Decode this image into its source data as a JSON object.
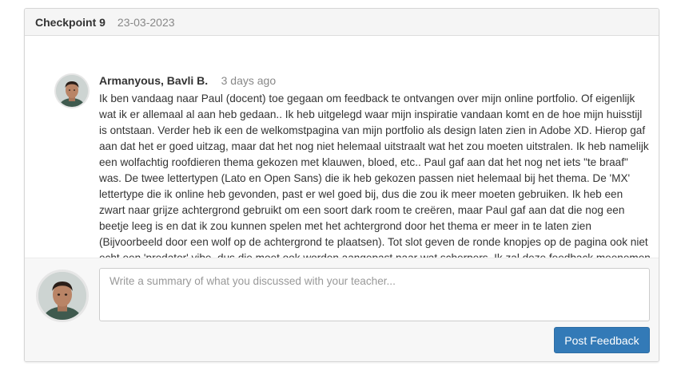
{
  "checkpoint": {
    "title": "Checkpoint 9",
    "date": "23-03-2023"
  },
  "comment": {
    "author": "Armanyous, Bavli B.",
    "time": "3 days ago",
    "text": "Ik ben vandaag naar Paul (docent) toe gegaan om feedback te ontvangen over mijn online portfolio. Of eigenlijk wat ik er allemaal al aan heb gedaan.. Ik heb uitgelegd waar mijn inspiratie vandaan komt en de hoe mijn huisstijl is ontstaan. Verder heb ik een de welkomstpagina van mijn portfolio als design laten zien in Adobe XD. Hierop gaf aan dat het er goed uitzag, maar dat het nog niet helemaal uitstraalt wat het zou moeten uitstralen. Ik heb namelijk een wolfachtig roofdieren thema gekozen met klauwen, bloed, etc.. Paul gaf aan dat het nog net iets \"te braaf\" was. De twee lettertypen (Lato en Open Sans) die ik heb gekozen passen niet helemaal bij het thema. De 'MX' lettertype die ik online heb gevonden, past er wel goed bij, dus die zou ik meer moeten gebruiken. Ik heb een zwart naar grijze achtergrond gebruikt om een soort dark room te creëren, maar Paul gaf aan dat die nog een beetje leeg is en dat ik zou kunnen spelen met het achtergrond door het thema er meer in te laten zien (Bijvoorbeeld door een wolf op de achtergrond te plaatsen). Tot slot geven de ronde knopjes op de pagina ook niet echt een 'predator' vibe, dus die moet ook worden aangepast naar wat scherpers. Ik zal deze feedback meenemen en toepassen op mijn portfolio."
  },
  "reply": {
    "placeholder": "Write a summary of what you discussed with your teacher...",
    "value": "",
    "button_label": "Post Feedback"
  },
  "colors": {
    "primary": "#337ab7",
    "muted_text": "#888888",
    "heading_bg": "#f5f5f5"
  }
}
